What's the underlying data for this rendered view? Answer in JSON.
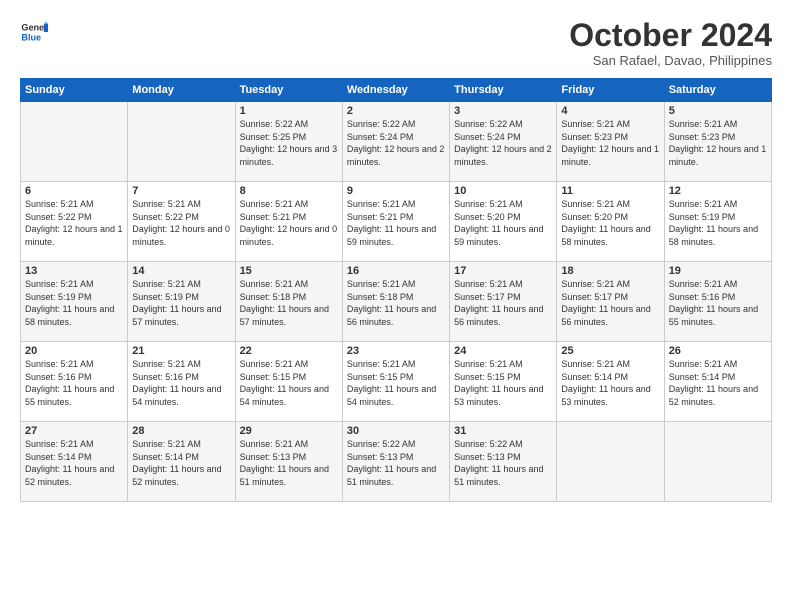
{
  "logo": {
    "line1": "General",
    "line2": "Blue"
  },
  "header": {
    "month": "October 2024",
    "location": "San Rafael, Davao, Philippines"
  },
  "weekdays": [
    "Sunday",
    "Monday",
    "Tuesday",
    "Wednesday",
    "Thursday",
    "Friday",
    "Saturday"
  ],
  "weeks": [
    [
      {
        "day": "",
        "info": ""
      },
      {
        "day": "",
        "info": ""
      },
      {
        "day": "1",
        "info": "Sunrise: 5:22 AM\nSunset: 5:25 PM\nDaylight: 12 hours and 3 minutes."
      },
      {
        "day": "2",
        "info": "Sunrise: 5:22 AM\nSunset: 5:24 PM\nDaylight: 12 hours and 2 minutes."
      },
      {
        "day": "3",
        "info": "Sunrise: 5:22 AM\nSunset: 5:24 PM\nDaylight: 12 hours and 2 minutes."
      },
      {
        "day": "4",
        "info": "Sunrise: 5:21 AM\nSunset: 5:23 PM\nDaylight: 12 hours and 1 minute."
      },
      {
        "day": "5",
        "info": "Sunrise: 5:21 AM\nSunset: 5:23 PM\nDaylight: 12 hours and 1 minute."
      }
    ],
    [
      {
        "day": "6",
        "info": "Sunrise: 5:21 AM\nSunset: 5:22 PM\nDaylight: 12 hours and 1 minute."
      },
      {
        "day": "7",
        "info": "Sunrise: 5:21 AM\nSunset: 5:22 PM\nDaylight: 12 hours and 0 minutes."
      },
      {
        "day": "8",
        "info": "Sunrise: 5:21 AM\nSunset: 5:21 PM\nDaylight: 12 hours and 0 minutes."
      },
      {
        "day": "9",
        "info": "Sunrise: 5:21 AM\nSunset: 5:21 PM\nDaylight: 11 hours and 59 minutes."
      },
      {
        "day": "10",
        "info": "Sunrise: 5:21 AM\nSunset: 5:20 PM\nDaylight: 11 hours and 59 minutes."
      },
      {
        "day": "11",
        "info": "Sunrise: 5:21 AM\nSunset: 5:20 PM\nDaylight: 11 hours and 58 minutes."
      },
      {
        "day": "12",
        "info": "Sunrise: 5:21 AM\nSunset: 5:19 PM\nDaylight: 11 hours and 58 minutes."
      }
    ],
    [
      {
        "day": "13",
        "info": "Sunrise: 5:21 AM\nSunset: 5:19 PM\nDaylight: 11 hours and 58 minutes."
      },
      {
        "day": "14",
        "info": "Sunrise: 5:21 AM\nSunset: 5:19 PM\nDaylight: 11 hours and 57 minutes."
      },
      {
        "day": "15",
        "info": "Sunrise: 5:21 AM\nSunset: 5:18 PM\nDaylight: 11 hours and 57 minutes."
      },
      {
        "day": "16",
        "info": "Sunrise: 5:21 AM\nSunset: 5:18 PM\nDaylight: 11 hours and 56 minutes."
      },
      {
        "day": "17",
        "info": "Sunrise: 5:21 AM\nSunset: 5:17 PM\nDaylight: 11 hours and 56 minutes."
      },
      {
        "day": "18",
        "info": "Sunrise: 5:21 AM\nSunset: 5:17 PM\nDaylight: 11 hours and 56 minutes."
      },
      {
        "day": "19",
        "info": "Sunrise: 5:21 AM\nSunset: 5:16 PM\nDaylight: 11 hours and 55 minutes."
      }
    ],
    [
      {
        "day": "20",
        "info": "Sunrise: 5:21 AM\nSunset: 5:16 PM\nDaylight: 11 hours and 55 minutes."
      },
      {
        "day": "21",
        "info": "Sunrise: 5:21 AM\nSunset: 5:16 PM\nDaylight: 11 hours and 54 minutes."
      },
      {
        "day": "22",
        "info": "Sunrise: 5:21 AM\nSunset: 5:15 PM\nDaylight: 11 hours and 54 minutes."
      },
      {
        "day": "23",
        "info": "Sunrise: 5:21 AM\nSunset: 5:15 PM\nDaylight: 11 hours and 54 minutes."
      },
      {
        "day": "24",
        "info": "Sunrise: 5:21 AM\nSunset: 5:15 PM\nDaylight: 11 hours and 53 minutes."
      },
      {
        "day": "25",
        "info": "Sunrise: 5:21 AM\nSunset: 5:14 PM\nDaylight: 11 hours and 53 minutes."
      },
      {
        "day": "26",
        "info": "Sunrise: 5:21 AM\nSunset: 5:14 PM\nDaylight: 11 hours and 52 minutes."
      }
    ],
    [
      {
        "day": "27",
        "info": "Sunrise: 5:21 AM\nSunset: 5:14 PM\nDaylight: 11 hours and 52 minutes."
      },
      {
        "day": "28",
        "info": "Sunrise: 5:21 AM\nSunset: 5:14 PM\nDaylight: 11 hours and 52 minutes."
      },
      {
        "day": "29",
        "info": "Sunrise: 5:21 AM\nSunset: 5:13 PM\nDaylight: 11 hours and 51 minutes."
      },
      {
        "day": "30",
        "info": "Sunrise: 5:22 AM\nSunset: 5:13 PM\nDaylight: 11 hours and 51 minutes."
      },
      {
        "day": "31",
        "info": "Sunrise: 5:22 AM\nSunset: 5:13 PM\nDaylight: 11 hours and 51 minutes."
      },
      {
        "day": "",
        "info": ""
      },
      {
        "day": "",
        "info": ""
      }
    ]
  ]
}
